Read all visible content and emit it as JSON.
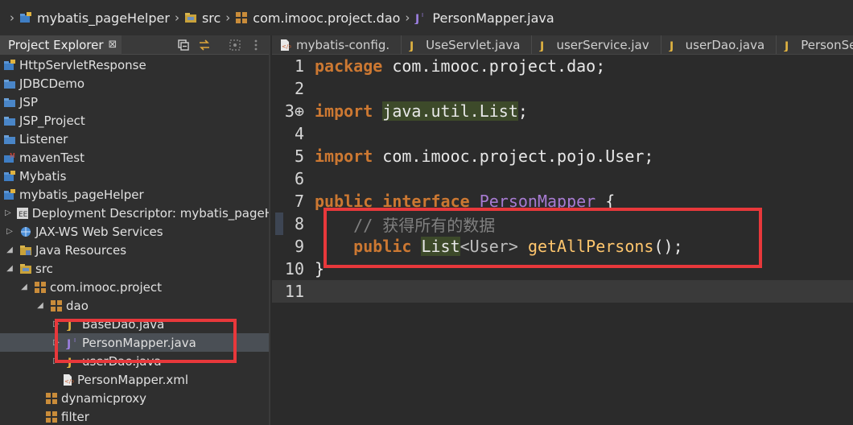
{
  "breadcrumb": {
    "items": [
      {
        "label": "mybatis_pageHelper",
        "icon": "project-icon"
      },
      {
        "label": "src",
        "icon": "source-folder-icon"
      },
      {
        "label": "com.imooc.project.dao",
        "icon": "package-icon"
      },
      {
        "label": "PersonMapper.java",
        "icon": "java-interface-icon"
      }
    ]
  },
  "explorer": {
    "title": "Project Explorer",
    "close": "⊠",
    "items": [
      {
        "label": "HttpServletResponse",
        "icon": "project-icon",
        "depth": 0,
        "twisty": ""
      },
      {
        "label": "JDBCDemo",
        "icon": "folder-icon",
        "depth": 0,
        "twisty": ""
      },
      {
        "label": "JSP",
        "icon": "folder-icon",
        "depth": 0,
        "twisty": ""
      },
      {
        "label": "JSP_Project",
        "icon": "folder-icon",
        "depth": 0,
        "twisty": ""
      },
      {
        "label": "Listener",
        "icon": "folder-icon",
        "depth": 0,
        "twisty": ""
      },
      {
        "label": "mavenTest",
        "icon": "maven-project-icon",
        "depth": 0,
        "twisty": ""
      },
      {
        "label": "Mybatis",
        "icon": "project-icon",
        "depth": 0,
        "twisty": ""
      },
      {
        "label": "mybatis_pageHelper",
        "icon": "project-icon",
        "depth": 0,
        "twisty": ""
      },
      {
        "label": "Deployment Descriptor: mybatis_pageH",
        "icon": "descriptor-icon",
        "depth": 1,
        "twisty": "▷"
      },
      {
        "label": "JAX-WS Web Services",
        "icon": "webservice-icon",
        "depth": 1,
        "twisty": "▷"
      },
      {
        "label": "Java Resources",
        "icon": "java-resources-icon",
        "depth": 1,
        "twisty": "◢"
      },
      {
        "label": "src",
        "icon": "source-folder-icon",
        "depth": 2,
        "twisty": "◢"
      },
      {
        "label": "com.imooc.project",
        "icon": "package-icon",
        "depth": 3,
        "twisty": "◢"
      },
      {
        "label": "dao",
        "icon": "package-icon",
        "depth": 4,
        "twisty": "◢"
      },
      {
        "label": "BaseDao.java",
        "icon": "java-class-icon",
        "depth": 5,
        "twisty": "▷"
      },
      {
        "label": "PersonMapper.java",
        "icon": "java-interface-icon",
        "depth": 5,
        "twisty": "▷",
        "selected": true
      },
      {
        "label": "userDao.java",
        "icon": "java-class-icon",
        "depth": 5,
        "twisty": "▷"
      },
      {
        "label": "PersonMapper.xml",
        "icon": "xml-file-icon",
        "depth": 5,
        "twisty": ""
      },
      {
        "label": "dynamicproxy",
        "icon": "package-icon",
        "depth": 4,
        "twisty": ""
      },
      {
        "label": "filter",
        "icon": "package-icon",
        "depth": 4,
        "twisty": ""
      }
    ]
  },
  "editor": {
    "tabs": [
      {
        "label": "mybatis-config.",
        "icon": "xml-file-icon"
      },
      {
        "label": "UseServlet.java",
        "icon": "java-class-icon"
      },
      {
        "label": "userService.jav",
        "icon": "java-class-icon"
      },
      {
        "label": "userDao.java",
        "icon": "java-class-icon"
      },
      {
        "label": "PersonServ",
        "icon": "java-class-icon"
      }
    ],
    "lines": [
      {
        "num": "1",
        "tokens": [
          {
            "t": "package",
            "c": "kw"
          },
          {
            "t": " com.imooc.project.dao;",
            "c": ""
          }
        ]
      },
      {
        "num": "2",
        "tokens": []
      },
      {
        "num": "3⊕",
        "tokens": [
          {
            "t": "import",
            "c": "kw"
          },
          {
            "t": " ",
            "c": ""
          },
          {
            "t": "java.util.List",
            "c": "type-hl"
          },
          {
            "t": ";",
            "c": ""
          }
        ]
      },
      {
        "num": "4",
        "tokens": []
      },
      {
        "num": "5",
        "tokens": [
          {
            "t": "import",
            "c": "kw"
          },
          {
            "t": " com.imooc.project.pojo.User;",
            "c": ""
          }
        ]
      },
      {
        "num": "6",
        "tokens": []
      },
      {
        "num": "7",
        "tokens": [
          {
            "t": "public",
            "c": "kw"
          },
          {
            "t": " ",
            "c": ""
          },
          {
            "t": "interface",
            "c": "kw"
          },
          {
            "t": " ",
            "c": ""
          },
          {
            "t": "PersonMapper",
            "c": "iface"
          },
          {
            "t": " {",
            "c": ""
          }
        ]
      },
      {
        "num": "8",
        "tokens": [
          {
            "t": "    ",
            "c": ""
          },
          {
            "t": "// 获得所有的数据",
            "c": "comment"
          }
        ]
      },
      {
        "num": "9",
        "tokens": [
          {
            "t": "    ",
            "c": ""
          },
          {
            "t": "public",
            "c": "kw"
          },
          {
            "t": " ",
            "c": ""
          },
          {
            "t": "List",
            "c": "type-hl"
          },
          {
            "t": "<User>",
            "c": "generic"
          },
          {
            "t": " ",
            "c": ""
          },
          {
            "t": "getAllPersons",
            "c": "method"
          },
          {
            "t": "();",
            "c": ""
          }
        ]
      },
      {
        "num": "10",
        "tokens": [
          {
            "t": "}",
            "c": ""
          }
        ]
      },
      {
        "num": "11",
        "tokens": [],
        "current": true
      }
    ]
  },
  "colors": {
    "highlight_box": "#e8383b",
    "keyword": "#cc7832",
    "method": "#ffc66d",
    "interface": "#a77bd1",
    "comment": "#808080"
  }
}
